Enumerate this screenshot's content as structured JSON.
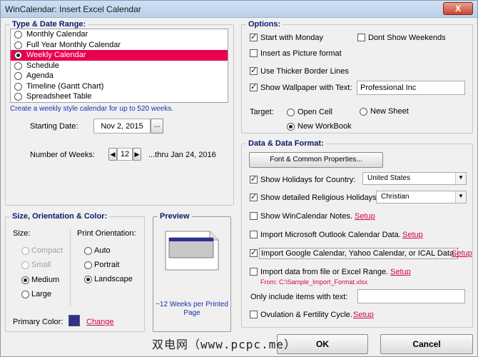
{
  "window": {
    "title": "WinCalendar: Insert Excel Calendar",
    "close_label": "X"
  },
  "type_range": {
    "title": "Type & Date Range:",
    "items": [
      {
        "label": "Monthly Calendar",
        "selected": false
      },
      {
        "label": "Full Year Monthly Calendar",
        "selected": false
      },
      {
        "label": "Weekly Calendar",
        "selected": true
      },
      {
        "label": "Schedule",
        "selected": false
      },
      {
        "label": "Agenda",
        "selected": false
      },
      {
        "label": "Timeline (Gantt Chart)",
        "selected": false
      },
      {
        "label": "Spreadsheet Table",
        "selected": false
      }
    ],
    "description": "Create a weekly style calendar for up to 520 weeks.",
    "starting_date_label": "Starting Date:",
    "starting_date_value": "Nov 2, 2015",
    "date_picker_label": "...",
    "weeks_label": "Number of Weeks:",
    "weeks_value": "12",
    "thru_label": "...thru Jan 24, 2016"
  },
  "options": {
    "title": "Options:",
    "start_monday": "Start with Monday",
    "dont_show_weekends": "Dont Show Weekends",
    "insert_picture": "Insert as Picture format",
    "thicker_border": "Use Thicker Border Lines",
    "show_wallpaper": "Show Wallpaper with Text:",
    "wallpaper_text": "Professional Inc",
    "target_label": "Target:",
    "open_cell": "Open Cell",
    "new_sheet": "New Sheet",
    "new_workbook": "New WorkBook"
  },
  "size_orientation": {
    "title": "Size, Orientation & Color:",
    "size_label": "Size:",
    "sizes": [
      "Compact",
      "Small",
      "Medium",
      "Large"
    ],
    "orientation_label": "Print Orientation:",
    "orientations": [
      "Auto",
      "Portrait",
      "Landscape"
    ],
    "primary_color_label": "Primary Color:",
    "primary_color": "#2e3192",
    "change_link": "Change"
  },
  "preview": {
    "title": "Preview",
    "caption": "~12 Weeks per Printed Page"
  },
  "data_format": {
    "title": "Data & Data Format:",
    "font_button": "Font & Common Properties...",
    "holidays_label": "Show Holidays for Country:",
    "holidays_value": "United States",
    "religious_label": "Show detailed Religious Holidays:",
    "religious_value": "Christian",
    "wincal_notes": "Show WinCalendar Notes.",
    "outlook": "Import Microsoft Outlook Calendar Data.",
    "google": "Import Google Calendar, Yahoo Calendar, or ICAL Data.",
    "import_file": "Import data from file or Excel Range.",
    "import_path": "From: C:\\Sample_Import_Format.xlsx",
    "only_include": "Only include items with text:",
    "ovulation": "Ovulation & Fertility Cycle.",
    "setup": "Setup"
  },
  "footer": {
    "ok": "OK",
    "cancel": "Cancel",
    "watermark": "双电网（www.pcpc.me）"
  }
}
